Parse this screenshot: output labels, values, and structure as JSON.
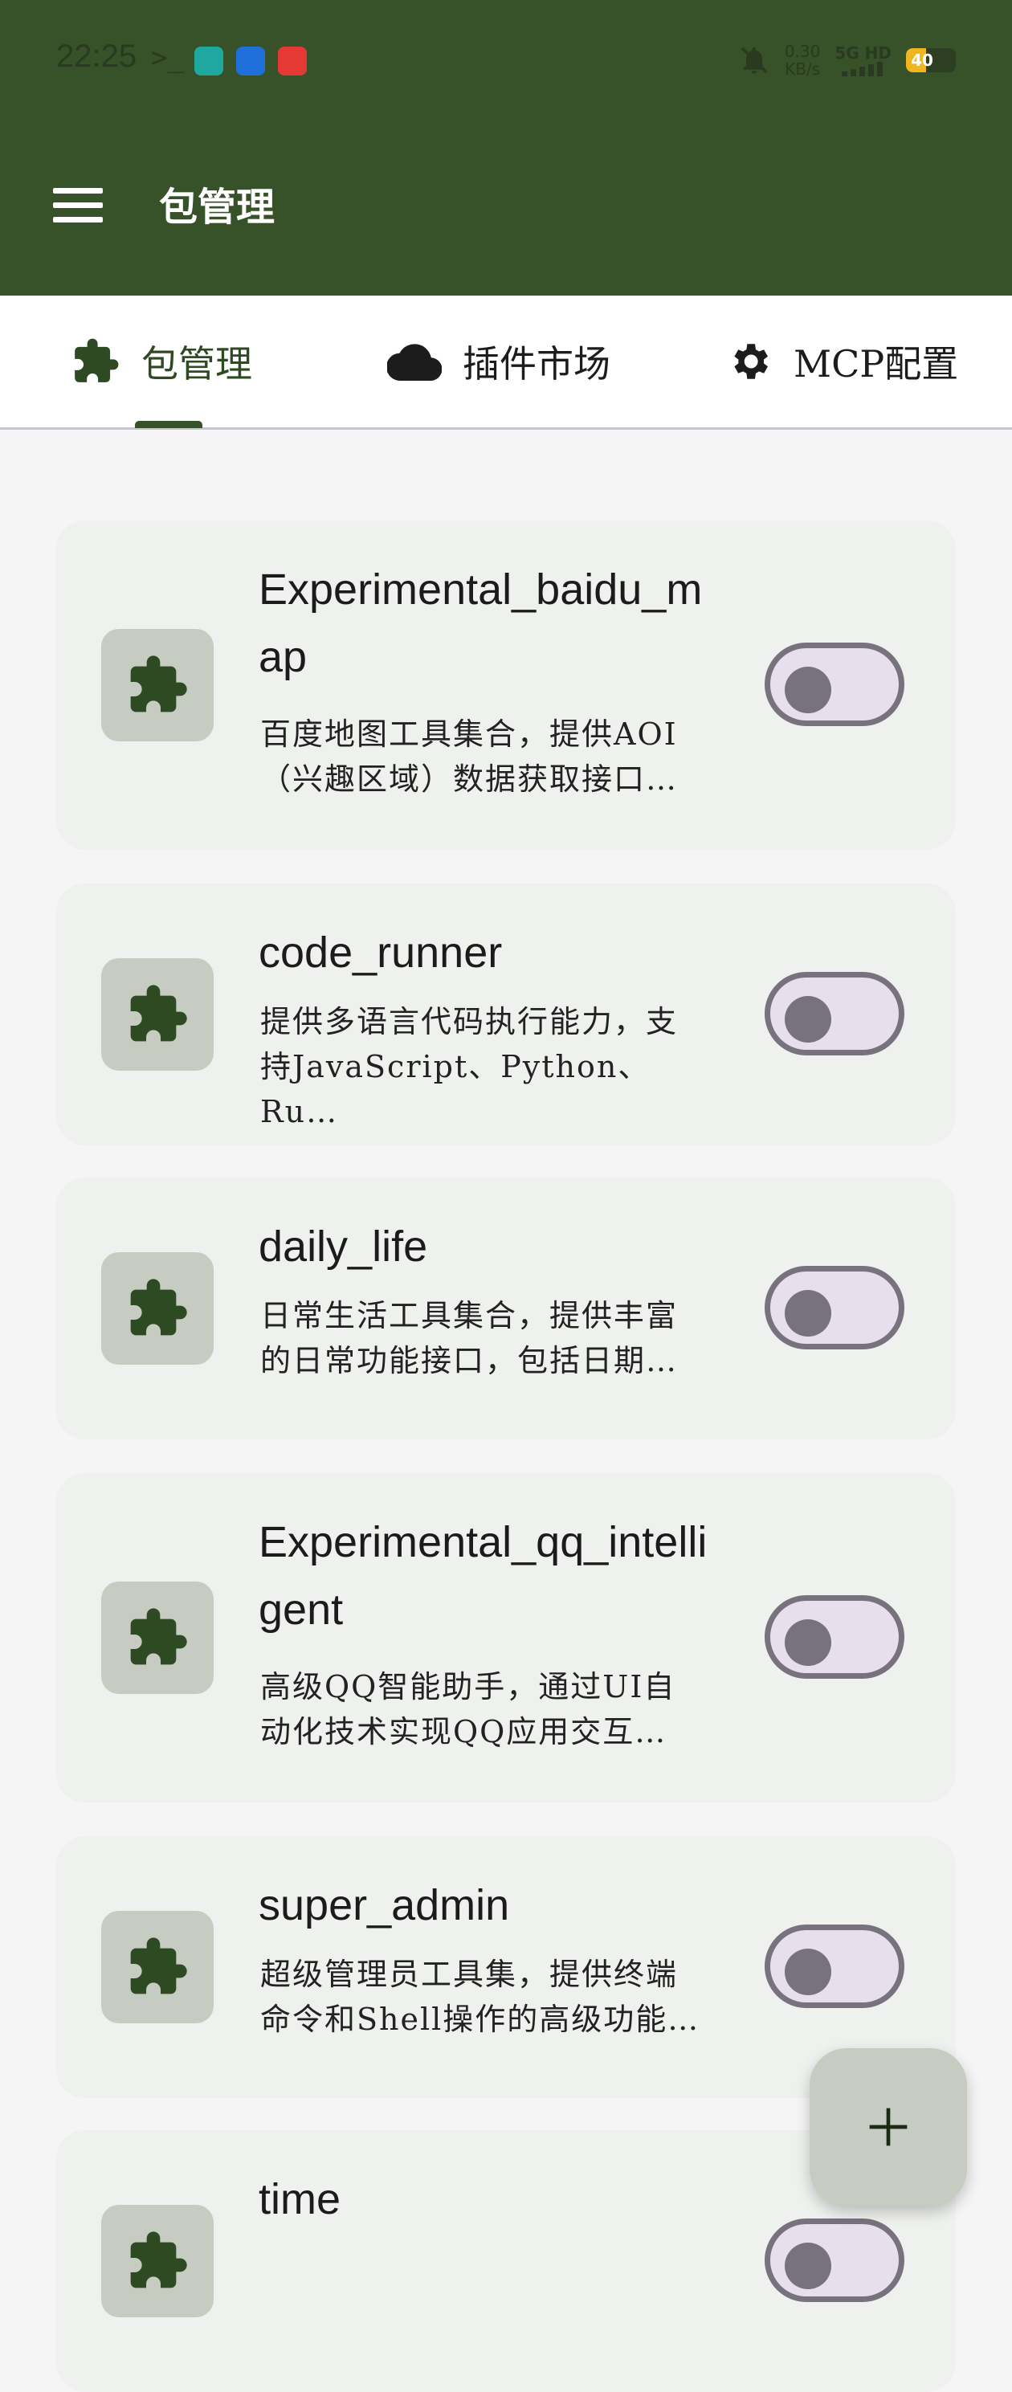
{
  "status_bar": {
    "time": "22:25",
    "prompt": ">_",
    "net_speed_value": "0.30",
    "net_speed_unit": "KB/s",
    "network": "5G HD",
    "battery_percent": "40",
    "battery_level": 0.4
  },
  "app_bar": {
    "title": "包管理",
    "menu_icon": "hamburger-menu-icon"
  },
  "tabs": [
    {
      "label": "包管理",
      "icon": "puzzle-icon",
      "active": true
    },
    {
      "label": "插件市场",
      "icon": "cloud-icon",
      "active": false
    },
    {
      "label": "MCP配置",
      "icon": "gear-icon",
      "active": false
    }
  ],
  "packages": [
    {
      "name": "Experimental_baidu_map",
      "description": "百度地图工具集合，提供AOI\n（兴趣区域）数据获取接口…",
      "enabled": false
    },
    {
      "name": "code_runner",
      "description": "提供多语言代码执行能力，支\n持JavaScript、Python、Ru…",
      "enabled": false
    },
    {
      "name": "daily_life",
      "description": "日常生活工具集合，提供丰富\n的日常功能接口，包括日期…",
      "enabled": false
    },
    {
      "name": "Experimental_qq_intelligent",
      "description": "高级QQ智能助手，通过UI自\n动化技术实现QQ应用交互…",
      "enabled": false
    },
    {
      "name": "super_admin",
      "description": "超级管理员工具集，提供终端\n命令和Shell操作的高级功能…",
      "enabled": false
    },
    {
      "name": "time",
      "description": "",
      "enabled": false
    }
  ],
  "fab": {
    "icon": "plus-icon"
  },
  "colors": {
    "primary": "#375128",
    "card_bg": "#eff1ee",
    "icon_box": "#c6ccc1",
    "toggle_outline": "#77727d",
    "toggle_track": "#e7e0ec"
  }
}
